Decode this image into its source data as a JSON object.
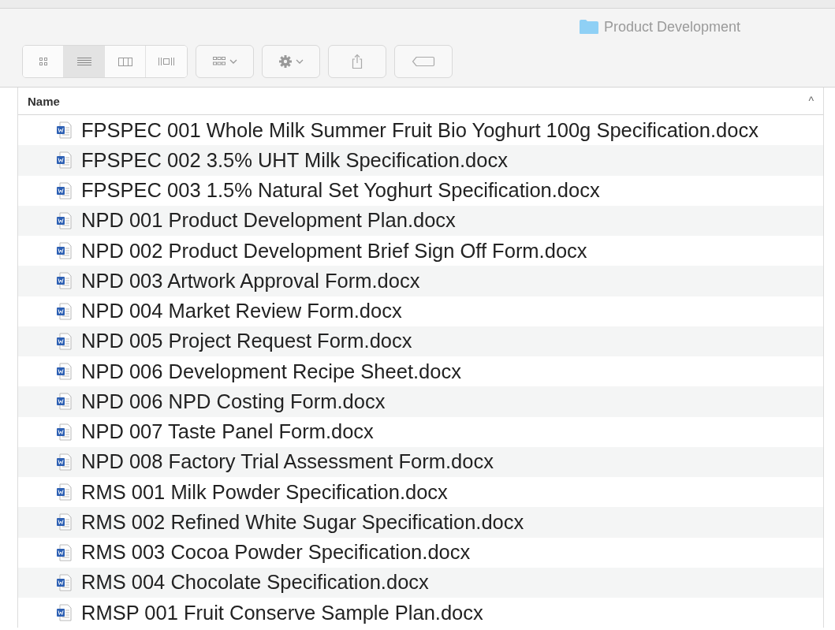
{
  "window": {
    "title": "Product Development"
  },
  "view_buttons": [
    {
      "kind": "icons",
      "selected": false
    },
    {
      "kind": "list",
      "selected": true
    },
    {
      "kind": "columns",
      "selected": false
    },
    {
      "kind": "coverflow",
      "selected": false
    }
  ],
  "toolbar_buttons": [
    {
      "kind": "arrange"
    },
    {
      "kind": "action"
    },
    {
      "kind": "share"
    },
    {
      "kind": "tags"
    }
  ],
  "table": {
    "columns": [
      {
        "label": "Name",
        "sort_caret": "^"
      }
    ],
    "rows": [
      {
        "name": "FPSPEC 001 Whole Milk Summer Fruit Bio Yoghurt 100g Specification.docx"
      },
      {
        "name": "FPSPEC 002 3.5% UHT Milk Specification.docx"
      },
      {
        "name": "FPSPEC 003 1.5% Natural Set Yoghurt Specification.docx"
      },
      {
        "name": "NPD 001 Product Development Plan.docx"
      },
      {
        "name": "NPD 002 Product Development Brief Sign Off Form.docx"
      },
      {
        "name": "NPD 003 Artwork Approval Form.docx"
      },
      {
        "name": "NPD 004 Market Review Form.docx"
      },
      {
        "name": "NPD 005 Project Request Form.docx"
      },
      {
        "name": "NPD 006 Development Recipe Sheet.docx"
      },
      {
        "name": "NPD 006 NPD Costing Form.docx"
      },
      {
        "name": "NPD 007 Taste Panel Form.docx"
      },
      {
        "name": "NPD 008 Factory Trial Assessment Form.docx"
      },
      {
        "name": "RMS 001 Milk Powder Specification.docx"
      },
      {
        "name": "RMS 002 Refined White Sugar Specification.docx"
      },
      {
        "name": "RMS 003 Cocoa Powder Specification.docx"
      },
      {
        "name": "RMS 004 Chocolate Specification.docx"
      },
      {
        "name": "RMSP 001 Fruit Conserve Sample Plan.docx"
      }
    ]
  }
}
